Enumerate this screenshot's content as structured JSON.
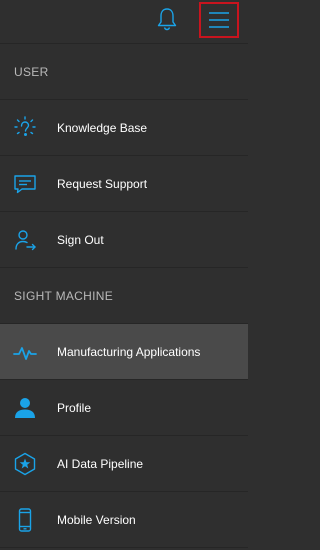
{
  "colors": {
    "background": "#2f2f2f",
    "active_background": "#4a4a4a",
    "accent": "#1aa3e8",
    "highlight_border": "#c8141e",
    "divider": "#262626"
  },
  "topbar": {
    "bell_icon": "bell-icon",
    "menu_icon": "hamburger-menu-icon"
  },
  "sections": {
    "user": {
      "title": "USER",
      "items": [
        {
          "label": "Knowledge Base",
          "icon": "lightbulb-icon"
        },
        {
          "label": "Request Support",
          "icon": "chat-icon"
        },
        {
          "label": "Sign Out",
          "icon": "sign-out-icon"
        }
      ]
    },
    "sight_machine": {
      "title": "SIGHT MACHINE",
      "items": [
        {
          "label": "Manufacturing Applications",
          "icon": "pulse-icon",
          "active": true
        },
        {
          "label": "Profile",
          "icon": "user-profile-icon"
        },
        {
          "label": "AI Data Pipeline",
          "icon": "hexagon-star-icon"
        },
        {
          "label": "Mobile Version",
          "icon": "mobile-phone-icon"
        }
      ]
    }
  }
}
